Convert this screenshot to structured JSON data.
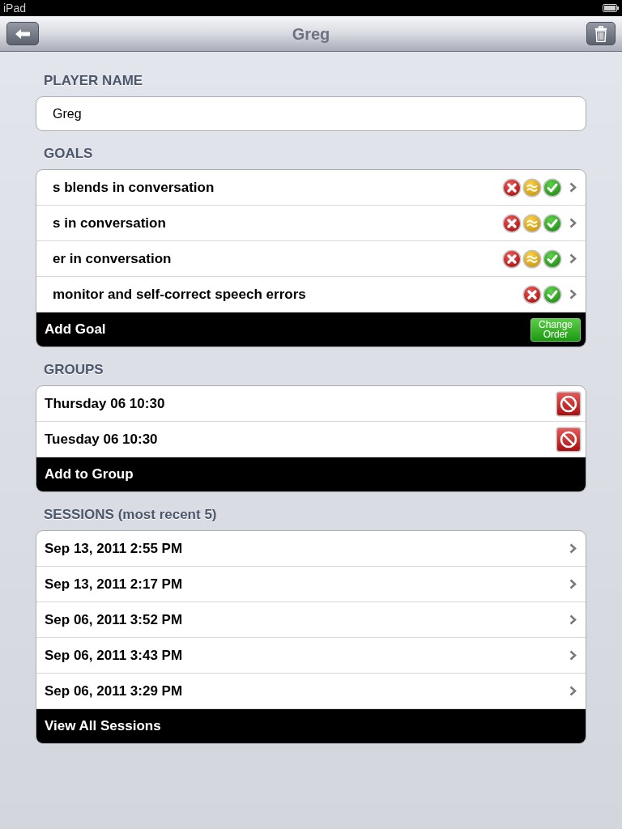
{
  "status_bar": {
    "device": "iPad"
  },
  "nav_bar": {
    "title": "Greg"
  },
  "player_name": {
    "label": "PLAYER NAME",
    "value": "Greg"
  },
  "goals": {
    "label": "GOALS",
    "items": [
      {
        "text": "s blends in conversation",
        "scores": [
          {
            "kind": "miss"
          },
          {
            "kind": "partial"
          },
          {
            "kind": "hit"
          }
        ]
      },
      {
        "text": "s in conversation",
        "scores": [
          {
            "kind": "miss"
          },
          {
            "kind": "partial"
          },
          {
            "kind": "hit"
          }
        ]
      },
      {
        "text": "er in conversation",
        "scores": [
          {
            "kind": "miss"
          },
          {
            "kind": "partial"
          },
          {
            "kind": "hit"
          }
        ]
      },
      {
        "text": "monitor and self-correct speech errors",
        "scores": [
          {
            "kind": "miss"
          },
          {
            "kind": "hit"
          }
        ]
      }
    ],
    "footer": {
      "label": "Add Goal",
      "button": "Change Order"
    }
  },
  "groups": {
    "label": "GROUPS",
    "items": [
      {
        "text": "Thursday 06 10:30"
      },
      {
        "text": "Tuesday 06 10:30"
      }
    ],
    "footer": {
      "label": "Add to Group"
    }
  },
  "sessions": {
    "label": "SESSIONS (most recent 5)",
    "items": [
      {
        "text": "Sep 13, 2011 2:55 PM"
      },
      {
        "text": "Sep 13, 2011 2:17 PM"
      },
      {
        "text": "Sep 06, 2011 3:52 PM"
      },
      {
        "text": "Sep 06, 2011 3:43 PM"
      },
      {
        "text": "Sep 06, 2011 3:29 PM"
      }
    ],
    "footer": {
      "label": "View All Sessions"
    }
  }
}
